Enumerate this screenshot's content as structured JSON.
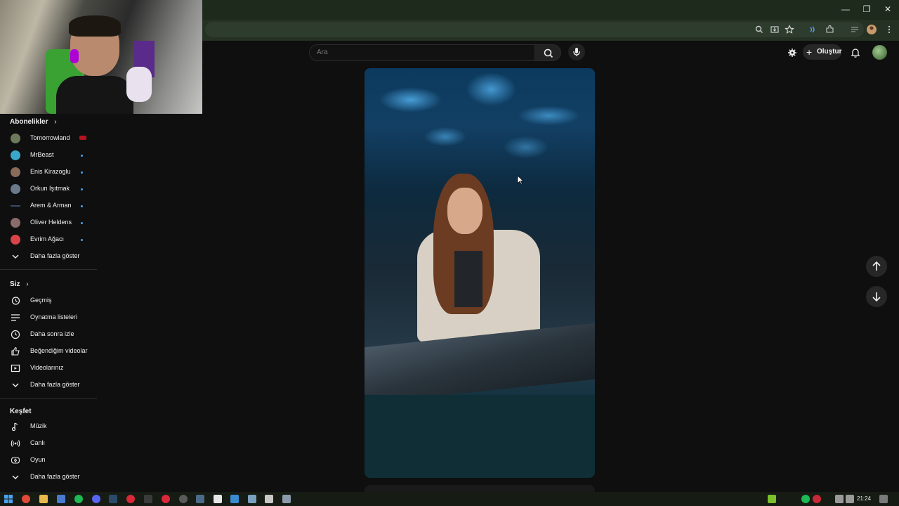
{
  "window": {
    "minimize_glyph": "—",
    "restore_glyph": "❐",
    "close_glyph": "✕"
  },
  "header": {
    "search_placeholder": "Ara",
    "create_label": "Oluştur",
    "create_glyph": "+"
  },
  "sidebar": {
    "subscriptions": {
      "title": "Abonelikler",
      "chevron": "›",
      "channels": [
        {
          "name": "Tomorrowland",
          "avatar_color": "#6d7a5a",
          "status": "live"
        },
        {
          "name": "MrBeast",
          "avatar_color": "#3aa6c9",
          "status": "new"
        },
        {
          "name": "Enis Kirazoglu",
          "avatar_color": "#8a6a5a",
          "status": "new"
        },
        {
          "name": "Orkun Işıtmak",
          "avatar_color": "#6a7a8a",
          "status": "new"
        },
        {
          "name": "Arem & Arman",
          "avatar_color": "#3a4a6a",
          "status": "new"
        },
        {
          "name": "Oliver Heldens",
          "avatar_color": "#8a6a6a",
          "status": "new"
        },
        {
          "name": "Evrim Ağacı",
          "avatar_color": "#d9444a",
          "status": "new"
        }
      ],
      "show_more": "Daha fazla göster"
    },
    "you": {
      "title": "Siz",
      "chevron": "›",
      "items": [
        {
          "label": "Geçmiş",
          "icon": "history-icon"
        },
        {
          "label": "Oynatma listeleri",
          "icon": "playlist-icon"
        },
        {
          "label": "Daha sonra izle",
          "icon": "clock-icon"
        },
        {
          "label": "Beğendiğim videolar",
          "icon": "thumbs-up-icon"
        },
        {
          "label": "Videolarınız",
          "icon": "video-icon"
        }
      ],
      "show_more": "Daha fazla göster"
    },
    "explore": {
      "title": "Keşfet",
      "items": [
        {
          "label": "Müzik",
          "icon": "music-icon"
        },
        {
          "label": "Canlı",
          "icon": "live-icon"
        },
        {
          "label": "Oyun",
          "icon": "gaming-icon"
        }
      ],
      "show_more": "Daha fazla göster"
    }
  },
  "taskbar": {
    "time": "21:24"
  },
  "colors": {
    "accent_blue": "#3ea6ff",
    "live_red": "#b4141e",
    "background": "#0f0f0f"
  }
}
